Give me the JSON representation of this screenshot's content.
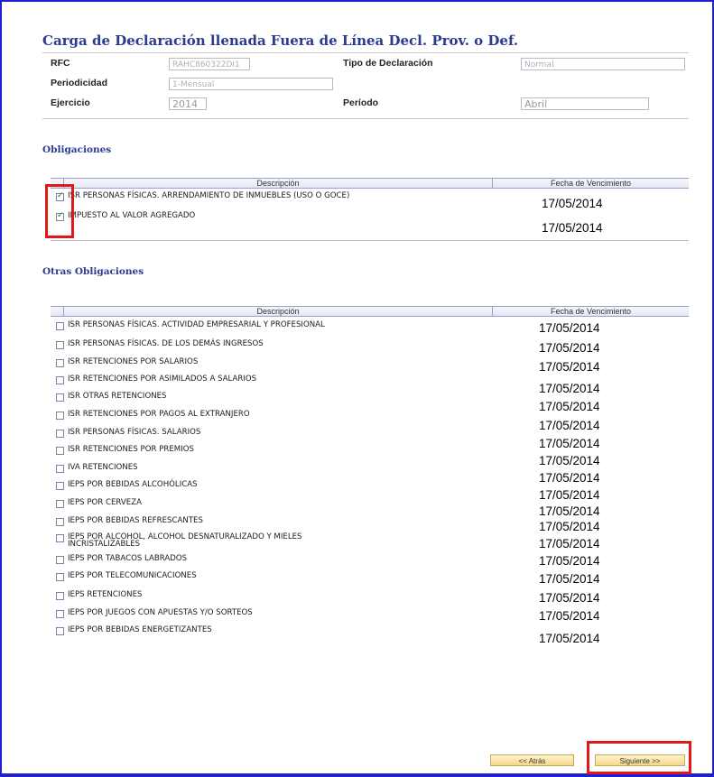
{
  "title": "Carga de Declaración llenada Fuera de Línea Decl. Prov. o Def.",
  "fields": {
    "rfc_label": "RFC",
    "rfc_value": "RAHC860322DI1",
    "tipo_label": "Tipo de Declaración",
    "tipo_value": "Normal",
    "periodicidad_label": "Periodicidad",
    "periodicidad_value": "1-Mensual",
    "ejercicio_label": "Ejercicio",
    "ejercicio_value": "2014",
    "periodo_label": "Período",
    "periodo_value": "Abril"
  },
  "obligaciones": {
    "heading": "Obligaciones",
    "col_desc": "Descripción",
    "col_fecha": "Fecha de Vencimiento",
    "rows": [
      {
        "desc": "ISR PERSONAS FÍSICAS. ARRENDAMIENTO DE INMUEBLES (USO O GOCE)",
        "fecha": "17/05/2014",
        "checked": true
      },
      {
        "desc": "IMPUESTO AL VALOR AGREGADO",
        "fecha": "17/05/2014",
        "checked": true
      }
    ]
  },
  "otras": {
    "heading": "Otras Obligaciones",
    "col_desc": "Descripción",
    "col_fecha": "Fecha de Vencimiento",
    "rows": [
      {
        "desc": "ISR PERSONAS FÍSICAS. ACTIVIDAD EMPRESARIAL Y PROFESIONAL",
        "fecha": "17/05/2014"
      },
      {
        "desc": "ISR PERSONAS FÍSICAS. DE LOS DEMÁS INGRESOS",
        "fecha": "17/05/2014"
      },
      {
        "desc": "ISR RETENCIONES POR SALARIOS",
        "fecha": "17/05/2014"
      },
      {
        "desc": "ISR RETENCIONES POR ASIMILADOS A SALARIOS",
        "fecha": "17/05/2014"
      },
      {
        "desc": "ISR OTRAS RETENCIONES",
        "fecha": "17/05/2014"
      },
      {
        "desc": "ISR RETENCIONES POR PAGOS AL EXTRANJERO",
        "fecha": "17/05/2014"
      },
      {
        "desc": "ISR PERSONAS FÍSICAS. SALARIOS",
        "fecha": "17/05/2014"
      },
      {
        "desc": "ISR RETENCIONES POR PREMIOS",
        "fecha": "17/05/2014"
      },
      {
        "desc": "IVA RETENCIONES",
        "fecha": "17/05/2014"
      },
      {
        "desc": "IEPS POR BEBIDAS ALCOHÓLICAS",
        "fecha": "17/05/2014"
      },
      {
        "desc": "IEPS POR CERVEZA",
        "fecha": "17/05/2014"
      },
      {
        "desc": "IEPS POR BEBIDAS REFRESCANTES",
        "fecha": "17/05/2014"
      },
      {
        "desc": "IEPS POR ALCOHOL, ALCOHOL DESNATURALIZADO Y MIELES",
        "desc2": "INCRISTALIZABLES",
        "fecha": "17/05/2014"
      },
      {
        "desc": "IEPS POR TABACOS LABRADOS",
        "fecha": "17/05/2014"
      },
      {
        "desc": "IEPS POR TELECOMUNICACIONES",
        "fecha": "17/05/2014"
      },
      {
        "desc": "IEPS RETENCIONES",
        "fecha": "17/05/2014"
      },
      {
        "desc": "IEPS POR JUEGOS CON APUESTAS Y/O SORTEOS",
        "fecha": "17/05/2014"
      },
      {
        "desc": "IEPS POR BEBIDAS ENERGETIZANTES",
        "fecha": "17/05/2014"
      }
    ]
  },
  "buttons": {
    "atras": "<< Atrás",
    "siguiente": "Siguiente >>"
  },
  "colors": {
    "frame": "#1f1fd1",
    "title": "#2b3b8f",
    "highlight": "#e01818",
    "button": "#f5d98a"
  }
}
